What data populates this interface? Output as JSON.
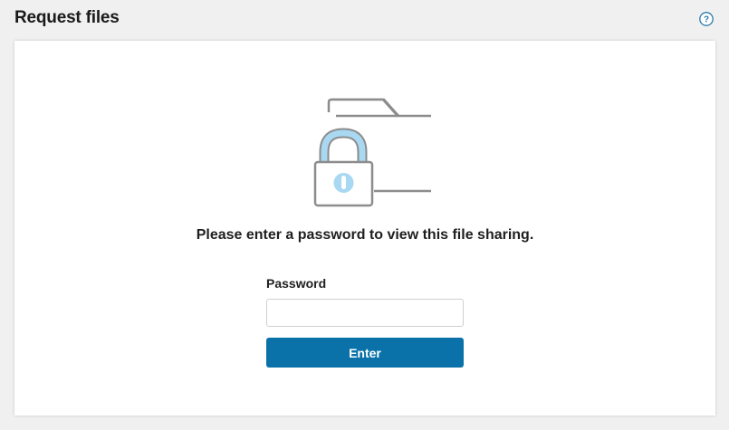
{
  "header": {
    "title": "Request files",
    "help_icon": "help-question-icon"
  },
  "panel": {
    "illustration_icon": "locked-folder-icon",
    "message": "Please enter a password to view this file sharing.",
    "password": {
      "label": "Password",
      "value": "",
      "placeholder": ""
    },
    "submit_label": "Enter"
  },
  "colors": {
    "page_background": "#f0f0f0",
    "panel_background": "#ffffff",
    "accent_button": "#0a72a8",
    "icon_outline": "#8c8c8c",
    "lock_fill": "#a9d8f2",
    "help_icon": "#2b79a8"
  }
}
